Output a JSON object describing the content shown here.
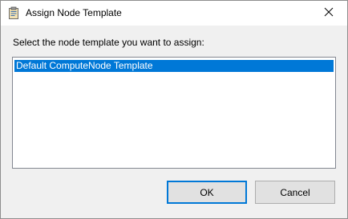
{
  "window": {
    "title": "Assign Node Template",
    "icon": "clipboard-icon",
    "close_icon": "close-icon"
  },
  "main": {
    "prompt": "Select the node template you want to assign:",
    "templates": [
      {
        "label": "Default ComputeNode Template",
        "selected": true
      }
    ]
  },
  "buttons": {
    "ok_label": "OK",
    "cancel_label": "Cancel"
  },
  "colors": {
    "selection": "#0078d7",
    "default_button_border": "#0078d7"
  }
}
